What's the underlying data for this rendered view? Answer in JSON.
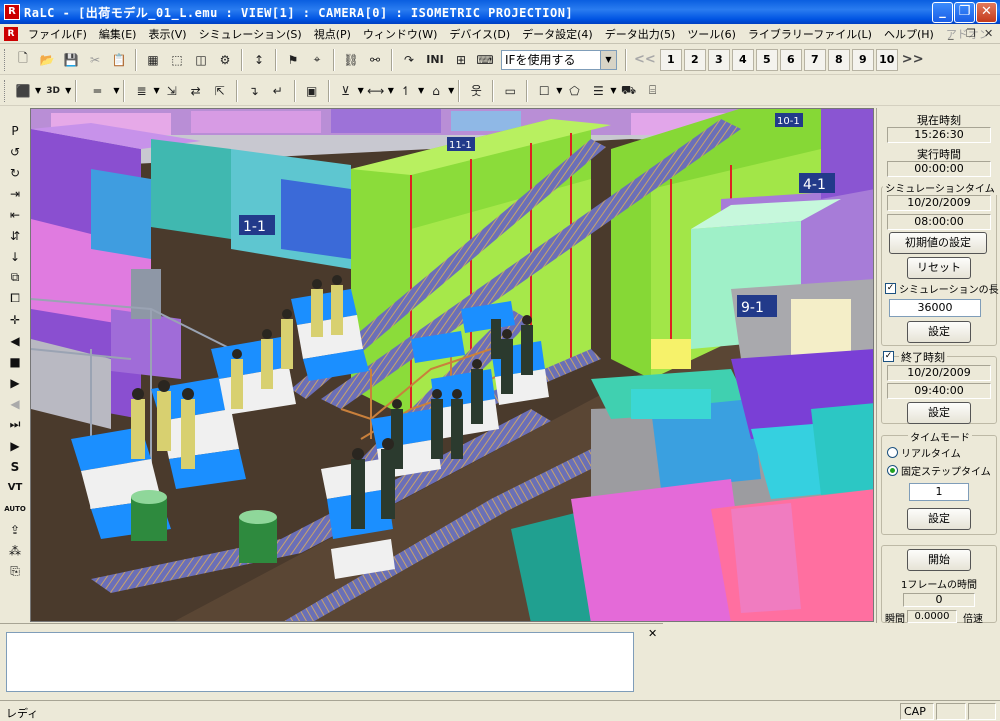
{
  "window": {
    "app_icon_letter": "R",
    "title": "RaLC - [出荷モデル_01_L.emu : VIEW[1] : CAMERA[0] : ISOMETRIC PROJECTION]"
  },
  "menu": {
    "items": [
      "ファイル(F)",
      "編集(E)",
      "表示(V)",
      "シミュレーション(S)",
      "視点(P)",
      "ウィンドウ(W)",
      "デバイス(D)",
      "データ設定(4)",
      "データ出力(5)",
      "ツール(6)",
      "ライブラリーファイル(L)",
      "ヘルプ(H)",
      "アドオン"
    ]
  },
  "toolbar": {
    "ini_label": "INI",
    "if_select_value": "IFを使用する",
    "prev_label": "<<",
    "next_label": ">>",
    "view_numbers": [
      "1",
      "2",
      "3",
      "4",
      "5",
      "6",
      "7",
      "8",
      "9",
      "10"
    ],
    "threed_label": "3D"
  },
  "scene_labels": [
    "1-1",
    "4-1",
    "9-1",
    "10-1",
    "11-1"
  ],
  "right_panel": {
    "current_time_label": "現在時刻",
    "current_time": "15:26:30",
    "exec_time_label": "実行時間",
    "exec_time": "00:00:00",
    "sim_time_title": "シミュレーションタイム",
    "sim_date": "10/20/2009",
    "sim_start": "08:00:00",
    "init_button": "初期値の設定",
    "reset_button": "リセット",
    "sim_length_label": "シミュレーションの長さ",
    "sim_length_checked": true,
    "sim_length_value": "36000",
    "set_button_1": "設定",
    "end_time_label": "終了時刻",
    "end_time_checked": true,
    "end_date": "10/20/2009",
    "end_time": "09:40:00",
    "set_button_2": "設定",
    "time_mode_title": "タイムモード",
    "realtime_label": "リアルタイム",
    "fixed_step_label": "固定ステップタイム",
    "fixed_step_value": "1",
    "set_button_3": "設定",
    "start_button": "開始",
    "frame_time_label": "1フレームの時間",
    "frame_time_value": "0",
    "instant_label": "瞬間",
    "instant_value": "0.0000",
    "speed_label": "倍速"
  },
  "status": {
    "text": "レディ",
    "cap": "CAP"
  }
}
